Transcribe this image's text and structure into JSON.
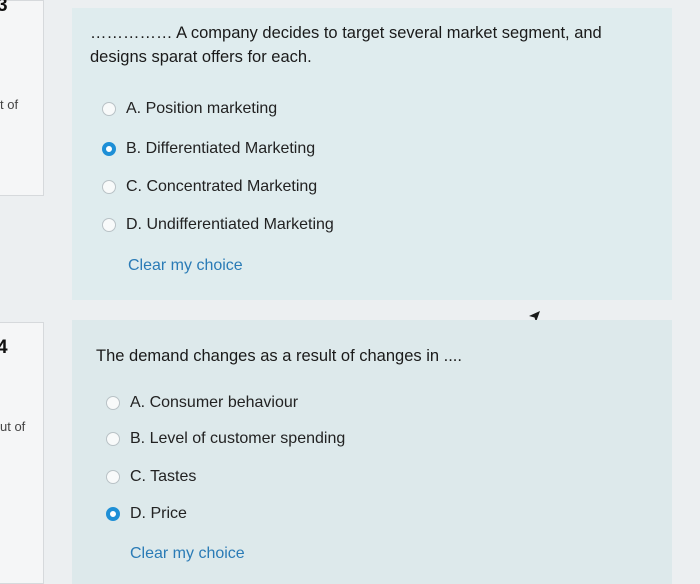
{
  "question3": {
    "number": "3",
    "side_text": "t of",
    "prompt_line1": "…………… A company decides to target several market segment, and",
    "prompt_line2": "designs sparat offers for each.",
    "options": [
      {
        "label": "A. Position marketing",
        "selected": false
      },
      {
        "label": "B. Differentiated Marketing",
        "selected": true
      },
      {
        "label": "C. Concentrated Marketing",
        "selected": false
      },
      {
        "label": "D. Undifferentiated Marketing",
        "selected": false
      }
    ],
    "clear_label": "Clear my choice"
  },
  "question4": {
    "number": "4",
    "side_text": "ut of",
    "prompt": "The demand changes as a result of changes in ....",
    "options": [
      {
        "label": "A. Consumer behaviour",
        "selected": false
      },
      {
        "label": "B. Level of customer spending",
        "selected": false
      },
      {
        "label": "C. Tastes",
        "selected": false
      },
      {
        "label": "D. Price",
        "selected": true
      }
    ],
    "clear_label": "Clear my choice"
  },
  "colors": {
    "accent": "#1e8fd6",
    "link": "#2a7bb6",
    "panel": "#dfecee"
  }
}
